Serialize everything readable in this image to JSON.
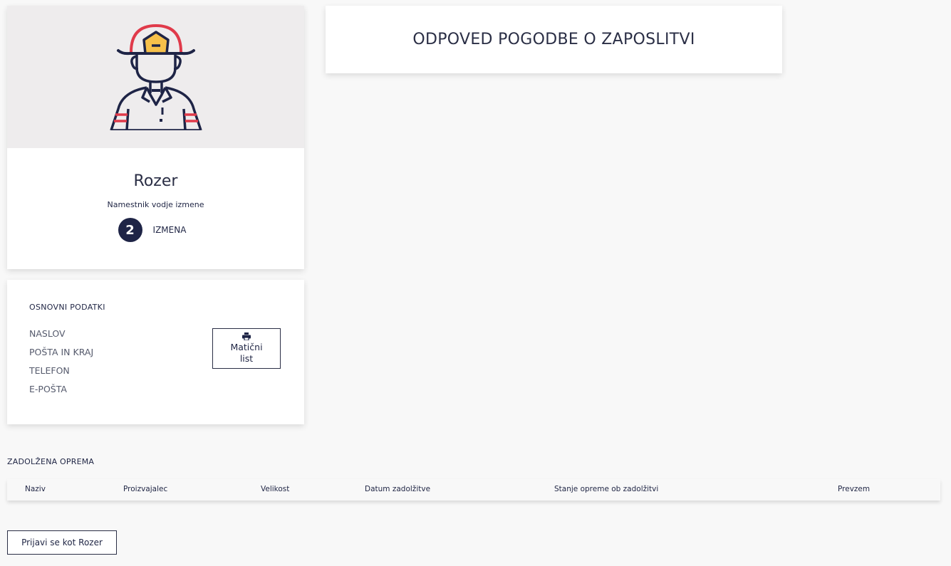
{
  "profile": {
    "name": "Rozer",
    "role": "Namestnik vodje izmene",
    "shift_number": "2",
    "shift_label": "IZMENA",
    "avatar_icon": "firefighter-avatar-icon"
  },
  "basic_info": {
    "title": "OSNOVNI PODATKI",
    "fields": [
      "NASLOV",
      "POŠTA IN KRAJ",
      "TELEFON",
      "E-POŠTA"
    ],
    "print_button_label": "Matični list",
    "print_icon": "printer-icon"
  },
  "document": {
    "title": "ODPOVED POGODBE O ZAPOSLITVI"
  },
  "equipment": {
    "title": "ZADOLŽENA OPREMA",
    "columns": [
      "Naziv",
      "Proizvajalec",
      "Velikost",
      "Datum zadolžitve",
      "Stanje opreme ob zadolžitvi",
      "Prevzem"
    ],
    "rows": []
  },
  "actions": {
    "login_as_label": "Prijavi se kot Rozer"
  },
  "colors": {
    "navy": "#1e2446",
    "accent_red": "#e03a4a",
    "helmet_yellow": "#f6c04a",
    "avatar_bg": "#eeeced"
  }
}
